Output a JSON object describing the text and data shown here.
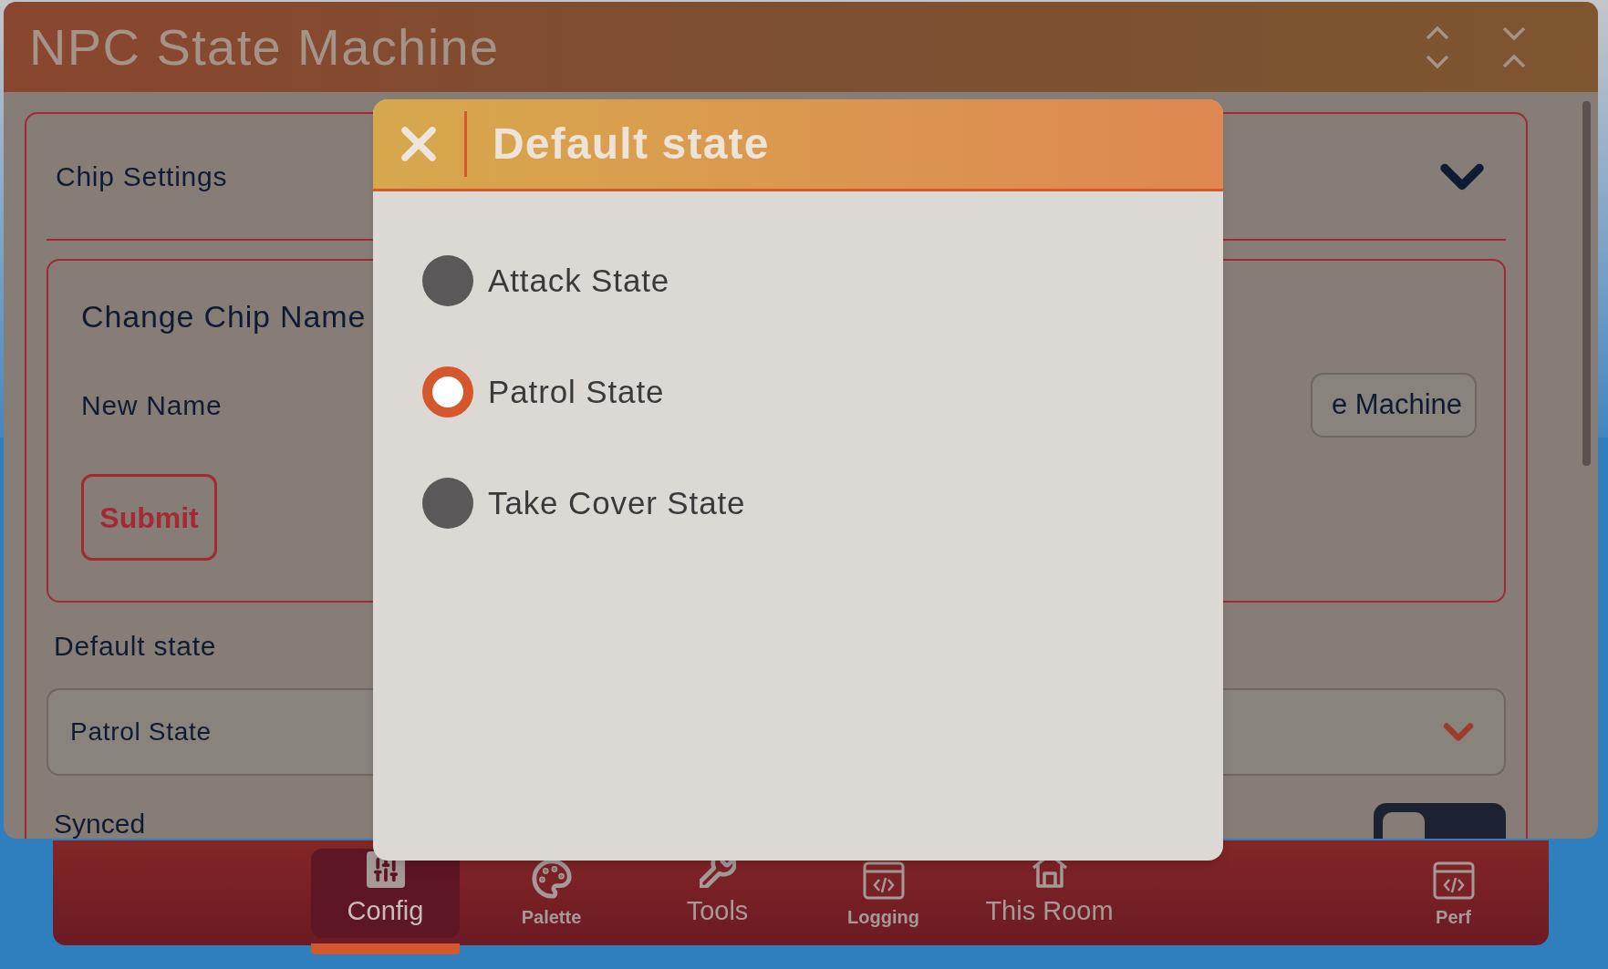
{
  "window": {
    "title": "NPC State Machine"
  },
  "chip_settings": {
    "title": "Chip Settings",
    "expanded": true
  },
  "change_name": {
    "title": "Change Chip Name",
    "field_label": "New Name",
    "field_value": "e Machine",
    "submit": "Submit"
  },
  "default_state": {
    "label": "Default state",
    "value": "Patrol State"
  },
  "synced": {
    "label": "Synced",
    "on": false
  },
  "modal": {
    "title": "Default state",
    "options": [
      {
        "label": "Attack State",
        "selected": false
      },
      {
        "label": "Patrol State",
        "selected": true
      },
      {
        "label": "Take Cover State",
        "selected": false
      }
    ]
  },
  "nav": {
    "items": [
      {
        "label": "Config",
        "kind": "large",
        "selected": true
      },
      {
        "label": "Palette",
        "kind": "small",
        "selected": false
      },
      {
        "label": "Tools",
        "kind": "large",
        "selected": false
      },
      {
        "label": "Logging",
        "kind": "small",
        "selected": false
      },
      {
        "label": "This Room",
        "kind": "large",
        "selected": false
      },
      {
        "label": "Perf",
        "kind": "small",
        "selected": false
      }
    ]
  }
}
